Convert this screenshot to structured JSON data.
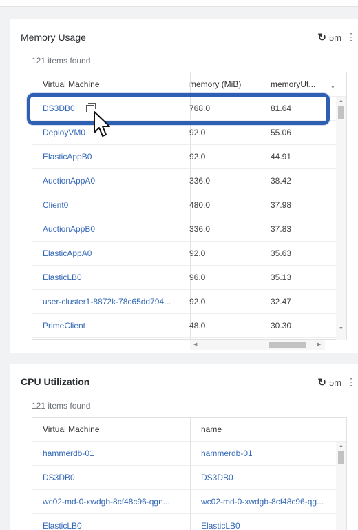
{
  "memory_panel": {
    "title": "Memory Usage",
    "refresh_label": "5m",
    "count_text": "121 items found",
    "columns": {
      "vm": "Virtual Machine",
      "memory": "memory (MiB)",
      "util": "memoryUt..."
    },
    "sort_icon": "sort-descending-arrow",
    "rows": [
      {
        "vm": "DS3DB0",
        "memory": "768.0",
        "util": "81.64"
      },
      {
        "vm": "DeployVM0",
        "memory": "92.0",
        "util": "55.06"
      },
      {
        "vm": "ElasticAppB0",
        "memory": "92.0",
        "util": "44.91"
      },
      {
        "vm": "AuctionAppA0",
        "memory": "336.0",
        "util": "38.42"
      },
      {
        "vm": "Client0",
        "memory": "480.0",
        "util": "37.98"
      },
      {
        "vm": "AuctionAppB0",
        "memory": "336.0",
        "util": "37.83"
      },
      {
        "vm": "ElasticAppA0",
        "memory": "92.0",
        "util": "35.63"
      },
      {
        "vm": "ElasticLB0",
        "memory": "96.0",
        "util": "35.13"
      },
      {
        "vm": "user-cluster1-8872k-78c65dd794...",
        "memory": "92.0",
        "util": "32.47"
      },
      {
        "vm": "PrimeClient",
        "memory": "48.0",
        "util": "30.30"
      }
    ]
  },
  "cpu_panel": {
    "title": "CPU Utilization",
    "refresh_label": "5m",
    "count_text": "121 items found",
    "columns": {
      "vm": "Virtual Machine",
      "name": "name"
    },
    "rows": [
      {
        "vm": "hammerdb-01",
        "name": "hammerdb-01"
      },
      {
        "vm": "DS3DB0",
        "name": "DS3DB0"
      },
      {
        "vm": "wc02-md-0-xwdgb-8cf48c96-qgn...",
        "name": "wc02-md-0-xwdgb-8cf48c96-qg..."
      },
      {
        "vm": "ElasticLB0",
        "name": "ElasticLB0"
      }
    ]
  },
  "colors": {
    "link": "#3569b8",
    "highlight": "#2f5fb3"
  }
}
